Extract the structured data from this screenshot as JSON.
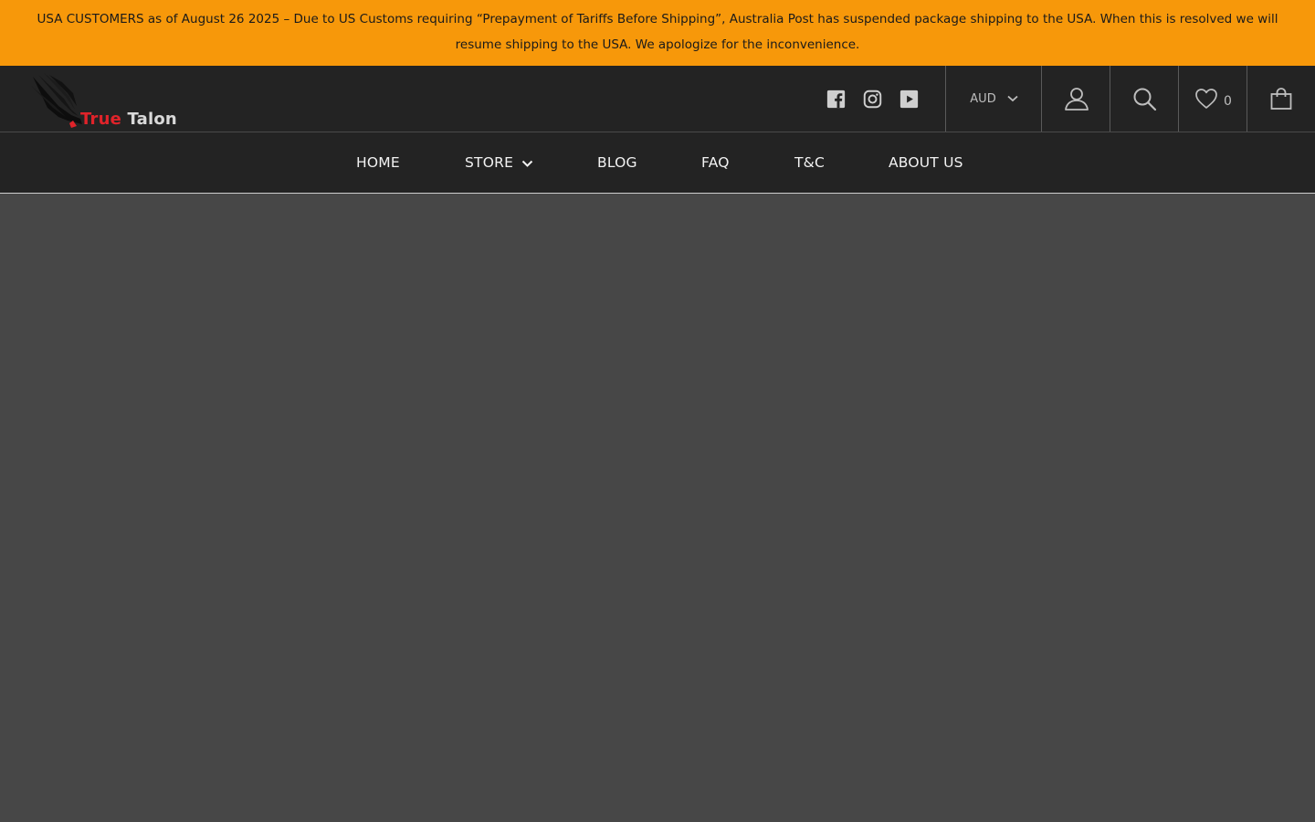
{
  "announcement": {
    "line1": "USA CUSTOMERS as of August 26 2025 – Due to US Customs requiring “Prepayment of Tariffs Before Shipping”, Australia Post has suspended package shipping to the USA. When this is resolved we will",
    "line2": "resume shipping to the USA. We apologize for the inconvenience."
  },
  "header": {
    "logo": {
      "word1": "True",
      "word2": "Talon",
      "icon": "eagle-logo"
    },
    "social": [
      {
        "name": "Facebook",
        "icon": "facebook-icon"
      },
      {
        "name": "Instagram",
        "icon": "instagram-icon"
      },
      {
        "name": "YouTube",
        "icon": "youtube-icon"
      }
    ],
    "currency": {
      "selected": "AUD",
      "icon": "chevron-down-icon"
    },
    "account_icon": "user-icon",
    "search_icon": "search-icon",
    "wishlist": {
      "icon": "heart-icon",
      "count": "0"
    },
    "cart_icon": "shopping-bag-icon"
  },
  "nav": {
    "items": [
      {
        "label": "HOME"
      },
      {
        "label": "STORE",
        "dropdown": true
      },
      {
        "label": "BLOG"
      },
      {
        "label": "FAQ"
      },
      {
        "label": "T&C"
      },
      {
        "label": "ABOUT US"
      }
    ]
  },
  "colors": {
    "announcement_bg": "#f7980a",
    "header_bg": "#232323",
    "page_bg": "#474747",
    "logo_red": "#e0232a"
  }
}
